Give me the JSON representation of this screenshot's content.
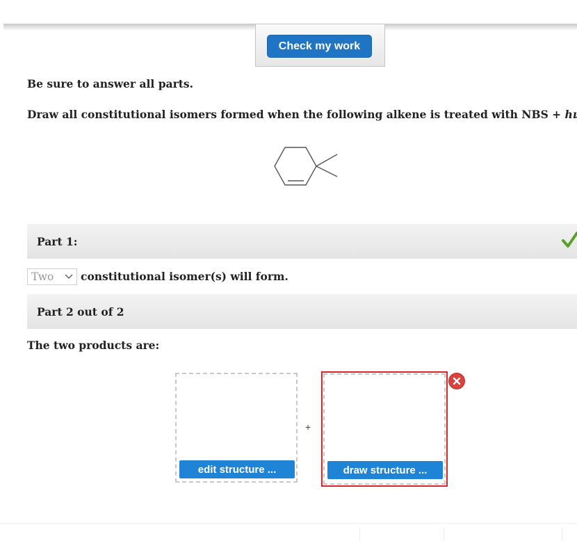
{
  "toolbar": {
    "check_label": "Check my work"
  },
  "instructions": {
    "line1": "Be sure to answer all parts.",
    "line2_prefix": "Draw all constitutional isomers formed when the following alkene is treated with NBS + ",
    "line2_hv": "hν",
    "line2_suffix": "."
  },
  "molecule": {
    "icon": "4,4-dimethylcyclohexene-structure"
  },
  "part1": {
    "label": "Part 1:",
    "status_icon": "checkmark-icon",
    "status_color": "#5aa02c",
    "select_value": "Two",
    "answer_text": "constitutional isomer(s) will form."
  },
  "part2": {
    "label": "Part 2 out of 2",
    "prompt": "The two products are:",
    "box1_button": "edit structure ...",
    "plus": "+",
    "box2_button": "draw structure ...",
    "error_color": "#d9252b"
  }
}
